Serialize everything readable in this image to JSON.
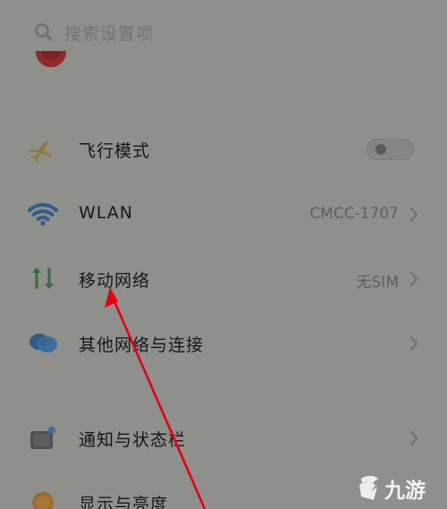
{
  "search": {
    "placeholder": "搜索设置项",
    "icon": "search-icon"
  },
  "partial_row": {
    "label": "",
    "icon": "partial-red-icon"
  },
  "settings": {
    "airplane": {
      "label": "飞行模式",
      "icon": "airplane-icon",
      "enabled": false
    },
    "wlan": {
      "label": "WLAN",
      "value": "CMCC-1707",
      "icon": "wifi-icon"
    },
    "mobile_network": {
      "label": "移动网络",
      "value": "无SIM",
      "icon": "mobile-network-icon"
    },
    "other_networks": {
      "label": "其他网络与连接",
      "icon": "connection-icon"
    },
    "notifications": {
      "label": "通知与状态栏",
      "icon": "notification-icon"
    },
    "display": {
      "label": "显示与亮度",
      "icon": "display-brightness-icon"
    }
  },
  "annotation": {
    "color": "#e60012",
    "icon": "red-arrow-icon"
  },
  "watermark": {
    "text": "九游",
    "icon": "nine-game-logo-icon"
  }
}
